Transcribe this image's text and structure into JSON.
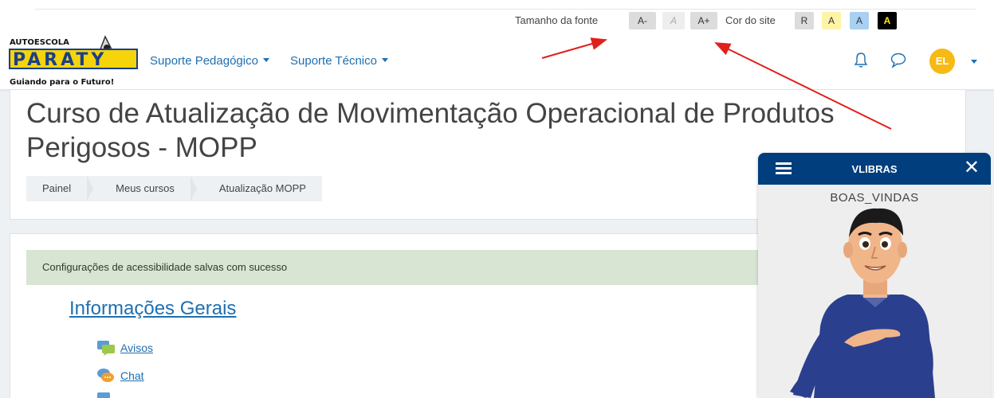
{
  "accessibility": {
    "font_size_label": "Tamanho da fonte",
    "font_decrease": "A-",
    "font_reset": "A",
    "font_increase": "A+",
    "site_color_label": "Cor do site",
    "color_reset": "R",
    "color_yellow": "A",
    "color_blue": "A",
    "color_black": "A"
  },
  "logo": {
    "top_text": "AUTOESCOLA",
    "brand": "PARATY",
    "tagline": "Guiando para o Futuro!"
  },
  "nav": {
    "items": [
      {
        "label": "Suporte Pedagógico"
      },
      {
        "label": "Suporte Técnico"
      }
    ],
    "notifications_icon": "bell-icon",
    "messages_icon": "chat-bubble-icon",
    "user_initials": "EL"
  },
  "course": {
    "title": "Curso de Atualização de Movimentação Operacional de Produtos Perigosos - MOPP",
    "breadcrumb": [
      "Painel",
      "Meus cursos",
      "Atualização MOPP"
    ]
  },
  "content": {
    "alert": "Configurações de acessibilidade salvas com sucesso",
    "section_title": "Informações Gerais",
    "activities": [
      {
        "label": "Avisos",
        "icon": "forum-icon"
      },
      {
        "label": "Chat",
        "icon": "chat-icon"
      }
    ]
  },
  "vlibras": {
    "title": "VLIBRAS",
    "current_sign": "BOAS_VINDAS"
  },
  "colors": {
    "link": "#1f6fb0",
    "vlibras_header": "#003e7e",
    "avatar": "#f7b914",
    "alert_bg": "#d9e5d3",
    "annotation_arrow": "#e0201c"
  }
}
